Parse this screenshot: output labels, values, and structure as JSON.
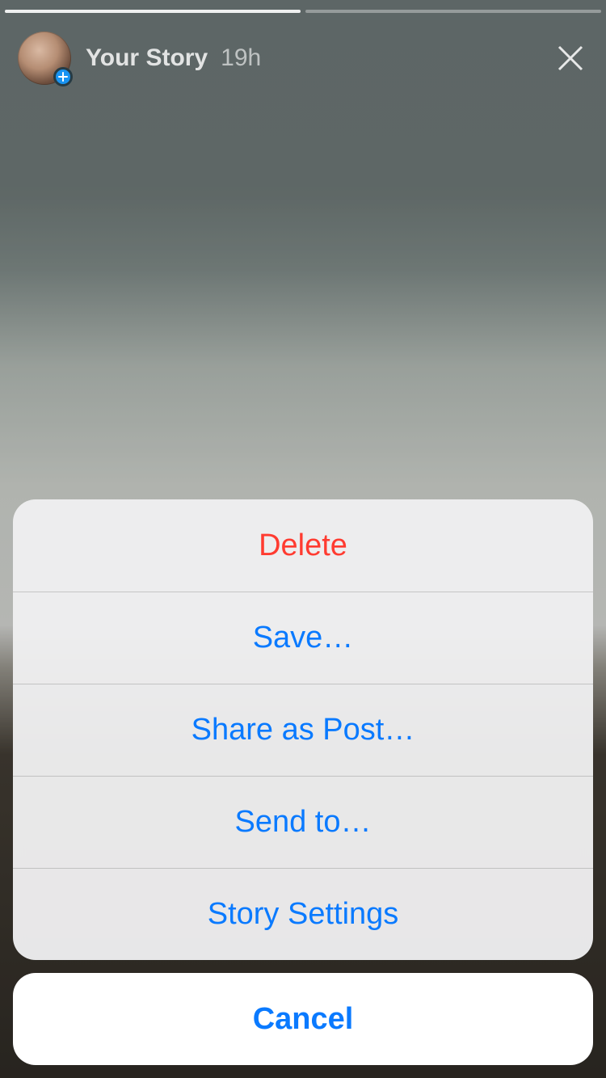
{
  "story": {
    "title": "Your Story",
    "time": "19h",
    "progress_segments": [
      {
        "fill_pct": 100
      },
      {
        "fill_pct": 0
      }
    ]
  },
  "icons": {
    "close": "close-icon",
    "plus": "plus-icon"
  },
  "action_sheet": {
    "items": [
      {
        "label": "Delete",
        "style": "destructive"
      },
      {
        "label": "Save…",
        "style": "default"
      },
      {
        "label": "Share as Post…",
        "style": "default"
      },
      {
        "label": "Send to…",
        "style": "default"
      },
      {
        "label": "Story Settings",
        "style": "default"
      }
    ],
    "cancel_label": "Cancel"
  },
  "colors": {
    "ios_blue": "#0a7aff",
    "ios_red": "#ff3b30",
    "plus_badge": "#1893f2"
  }
}
